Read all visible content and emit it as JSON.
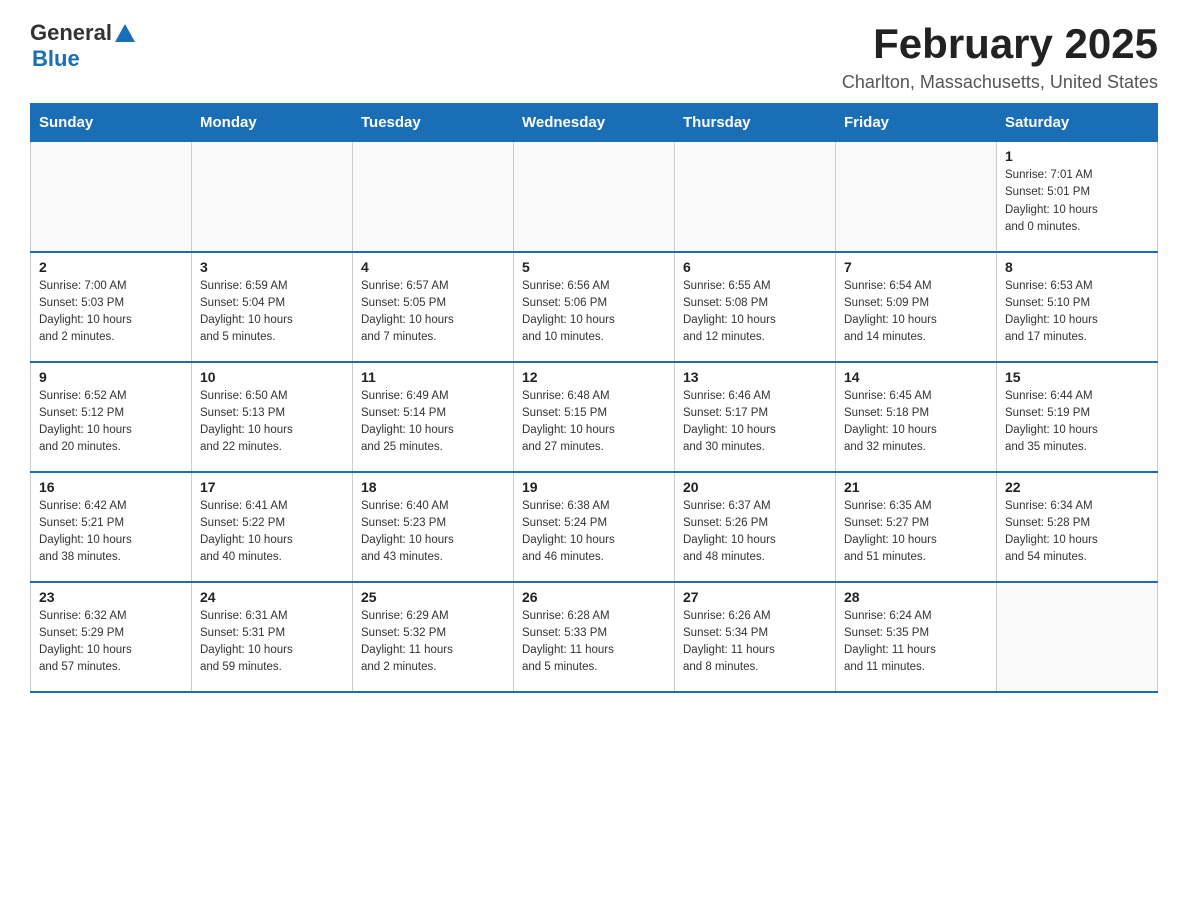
{
  "header": {
    "logo_general": "General",
    "logo_blue": "Blue",
    "title": "February 2025",
    "subtitle": "Charlton, Massachusetts, United States"
  },
  "days_of_week": [
    "Sunday",
    "Monday",
    "Tuesday",
    "Wednesday",
    "Thursday",
    "Friday",
    "Saturday"
  ],
  "weeks": [
    [
      {
        "day": "",
        "info": ""
      },
      {
        "day": "",
        "info": ""
      },
      {
        "day": "",
        "info": ""
      },
      {
        "day": "",
        "info": ""
      },
      {
        "day": "",
        "info": ""
      },
      {
        "day": "",
        "info": ""
      },
      {
        "day": "1",
        "info": "Sunrise: 7:01 AM\nSunset: 5:01 PM\nDaylight: 10 hours\nand 0 minutes."
      }
    ],
    [
      {
        "day": "2",
        "info": "Sunrise: 7:00 AM\nSunset: 5:03 PM\nDaylight: 10 hours\nand 2 minutes."
      },
      {
        "day": "3",
        "info": "Sunrise: 6:59 AM\nSunset: 5:04 PM\nDaylight: 10 hours\nand 5 minutes."
      },
      {
        "day": "4",
        "info": "Sunrise: 6:57 AM\nSunset: 5:05 PM\nDaylight: 10 hours\nand 7 minutes."
      },
      {
        "day": "5",
        "info": "Sunrise: 6:56 AM\nSunset: 5:06 PM\nDaylight: 10 hours\nand 10 minutes."
      },
      {
        "day": "6",
        "info": "Sunrise: 6:55 AM\nSunset: 5:08 PM\nDaylight: 10 hours\nand 12 minutes."
      },
      {
        "day": "7",
        "info": "Sunrise: 6:54 AM\nSunset: 5:09 PM\nDaylight: 10 hours\nand 14 minutes."
      },
      {
        "day": "8",
        "info": "Sunrise: 6:53 AM\nSunset: 5:10 PM\nDaylight: 10 hours\nand 17 minutes."
      }
    ],
    [
      {
        "day": "9",
        "info": "Sunrise: 6:52 AM\nSunset: 5:12 PM\nDaylight: 10 hours\nand 20 minutes."
      },
      {
        "day": "10",
        "info": "Sunrise: 6:50 AM\nSunset: 5:13 PM\nDaylight: 10 hours\nand 22 minutes."
      },
      {
        "day": "11",
        "info": "Sunrise: 6:49 AM\nSunset: 5:14 PM\nDaylight: 10 hours\nand 25 minutes."
      },
      {
        "day": "12",
        "info": "Sunrise: 6:48 AM\nSunset: 5:15 PM\nDaylight: 10 hours\nand 27 minutes."
      },
      {
        "day": "13",
        "info": "Sunrise: 6:46 AM\nSunset: 5:17 PM\nDaylight: 10 hours\nand 30 minutes."
      },
      {
        "day": "14",
        "info": "Sunrise: 6:45 AM\nSunset: 5:18 PM\nDaylight: 10 hours\nand 32 minutes."
      },
      {
        "day": "15",
        "info": "Sunrise: 6:44 AM\nSunset: 5:19 PM\nDaylight: 10 hours\nand 35 minutes."
      }
    ],
    [
      {
        "day": "16",
        "info": "Sunrise: 6:42 AM\nSunset: 5:21 PM\nDaylight: 10 hours\nand 38 minutes."
      },
      {
        "day": "17",
        "info": "Sunrise: 6:41 AM\nSunset: 5:22 PM\nDaylight: 10 hours\nand 40 minutes."
      },
      {
        "day": "18",
        "info": "Sunrise: 6:40 AM\nSunset: 5:23 PM\nDaylight: 10 hours\nand 43 minutes."
      },
      {
        "day": "19",
        "info": "Sunrise: 6:38 AM\nSunset: 5:24 PM\nDaylight: 10 hours\nand 46 minutes."
      },
      {
        "day": "20",
        "info": "Sunrise: 6:37 AM\nSunset: 5:26 PM\nDaylight: 10 hours\nand 48 minutes."
      },
      {
        "day": "21",
        "info": "Sunrise: 6:35 AM\nSunset: 5:27 PM\nDaylight: 10 hours\nand 51 minutes."
      },
      {
        "day": "22",
        "info": "Sunrise: 6:34 AM\nSunset: 5:28 PM\nDaylight: 10 hours\nand 54 minutes."
      }
    ],
    [
      {
        "day": "23",
        "info": "Sunrise: 6:32 AM\nSunset: 5:29 PM\nDaylight: 10 hours\nand 57 minutes."
      },
      {
        "day": "24",
        "info": "Sunrise: 6:31 AM\nSunset: 5:31 PM\nDaylight: 10 hours\nand 59 minutes."
      },
      {
        "day": "25",
        "info": "Sunrise: 6:29 AM\nSunset: 5:32 PM\nDaylight: 11 hours\nand 2 minutes."
      },
      {
        "day": "26",
        "info": "Sunrise: 6:28 AM\nSunset: 5:33 PM\nDaylight: 11 hours\nand 5 minutes."
      },
      {
        "day": "27",
        "info": "Sunrise: 6:26 AM\nSunset: 5:34 PM\nDaylight: 11 hours\nand 8 minutes."
      },
      {
        "day": "28",
        "info": "Sunrise: 6:24 AM\nSunset: 5:35 PM\nDaylight: 11 hours\nand 11 minutes."
      },
      {
        "day": "",
        "info": ""
      }
    ]
  ]
}
